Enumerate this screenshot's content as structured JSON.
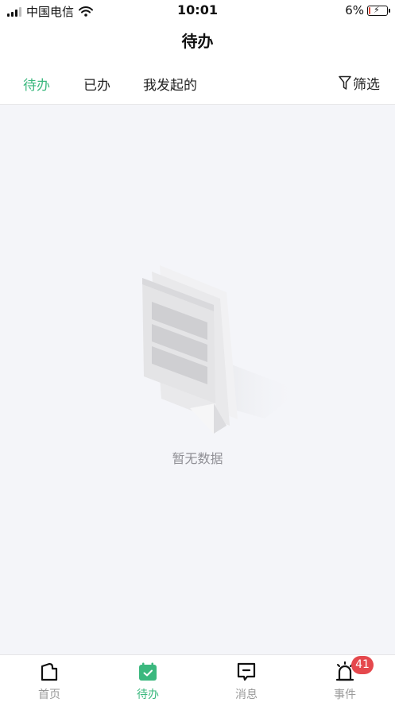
{
  "status_bar": {
    "carrier": "中国电信",
    "time": "10:01",
    "battery_percent": "6%",
    "battery_level": 0.06
  },
  "header": {
    "title": "待办"
  },
  "tabs": [
    {
      "label": "待办",
      "active": true
    },
    {
      "label": "已办",
      "active": false
    },
    {
      "label": "我发起的",
      "active": false
    }
  ],
  "filter": {
    "label": "筛选",
    "icon": "filter-icon"
  },
  "empty_state": {
    "text": "暂无数据",
    "icon": "empty-documents-illustration"
  },
  "tab_bar": {
    "items": [
      {
        "label": "首页",
        "icon": "home-icon",
        "active": false
      },
      {
        "label": "待办",
        "icon": "calendar-check-icon",
        "active": true
      },
      {
        "label": "消息",
        "icon": "message-icon",
        "active": false
      },
      {
        "label": "事件",
        "icon": "alarm-icon",
        "active": false,
        "badge": "41"
      }
    ]
  },
  "colors": {
    "accent": "#3bb87e",
    "badge": "#e5484d",
    "background": "#f4f5f9"
  }
}
